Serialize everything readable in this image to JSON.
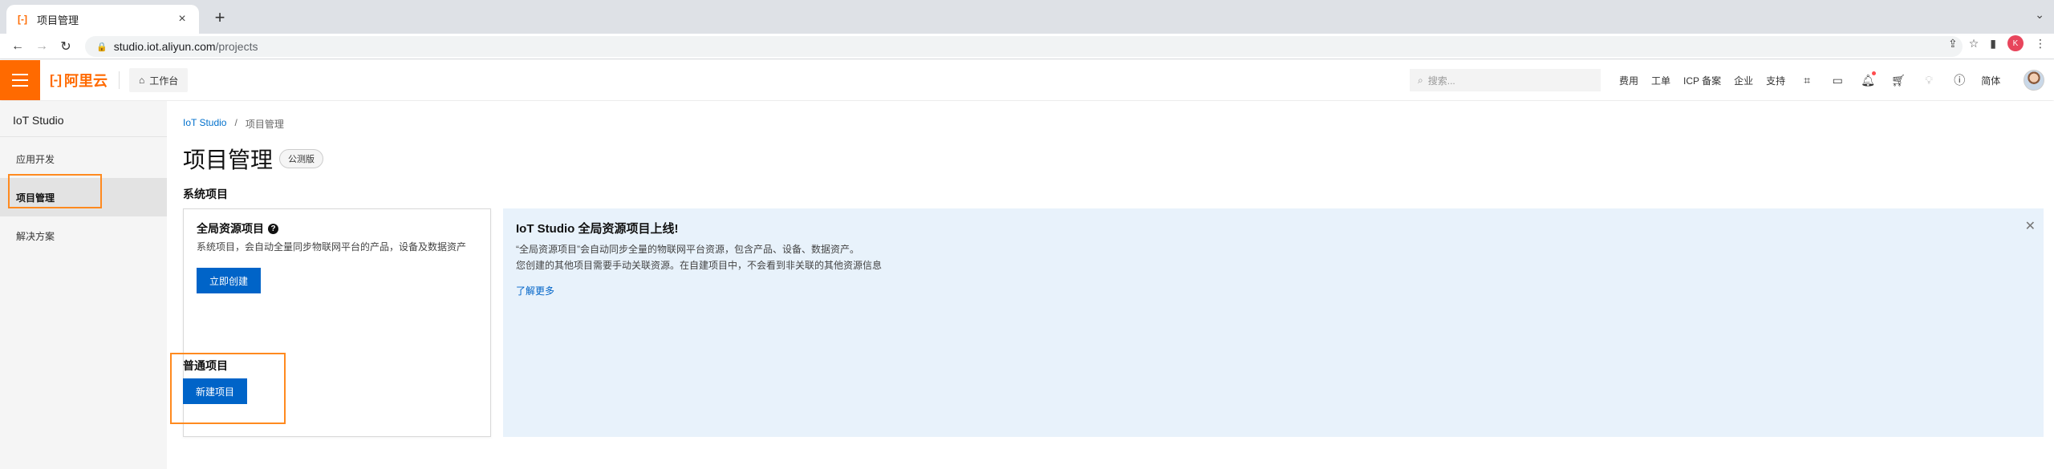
{
  "browser": {
    "tab_title": "项目管理",
    "new_tab_symbol": "+",
    "tab_menu_symbol": "⌄",
    "url_host": "studio.iot.aliyun.com",
    "url_path": "/projects",
    "profile_initial": "K"
  },
  "topbar": {
    "logo_text": "阿里云",
    "workbench_label": "工作台",
    "search_placeholder": "搜索...",
    "links": [
      "费用",
      "工单",
      "ICP 备案",
      "企业",
      "支持"
    ],
    "language_label": "简体",
    "accent_color": "#ff6a00"
  },
  "sidebar": {
    "title": "IoT Studio",
    "items": [
      {
        "label": "应用开发"
      },
      {
        "label": "项目管理"
      },
      {
        "label": "解决方案"
      }
    ]
  },
  "main": {
    "breadcrumb": [
      "IoT Studio",
      "项目管理"
    ],
    "breadcrumb_separator": "/",
    "page_title": "项目管理",
    "badge": "公测版",
    "system_section": "系统项目",
    "global_card": {
      "title": "全局资源项目",
      "help_symbol": "?",
      "description": "系统项目，会自动全量同步物联网平台的产品，设备及数据资产",
      "button": "立即创建"
    },
    "notice": {
      "title": "IoT Studio 全局资源项目上线!",
      "line1": "“全局资源项目”会自动同步全量的物联网平台资源，包含产品、设备、数据资产。",
      "line2": "您创建的其他项目需要手动关联资源。在自建项目中，不会看到非关联的其他资源信息",
      "link": "了解更多",
      "close_symbol": "✕"
    },
    "normal_section": "普通项目",
    "new_project_button": "新建项目"
  },
  "colors": {
    "primary": "#0064c8",
    "highlight": "#ff8a1f",
    "notice_bg": "#e8f2fb"
  }
}
